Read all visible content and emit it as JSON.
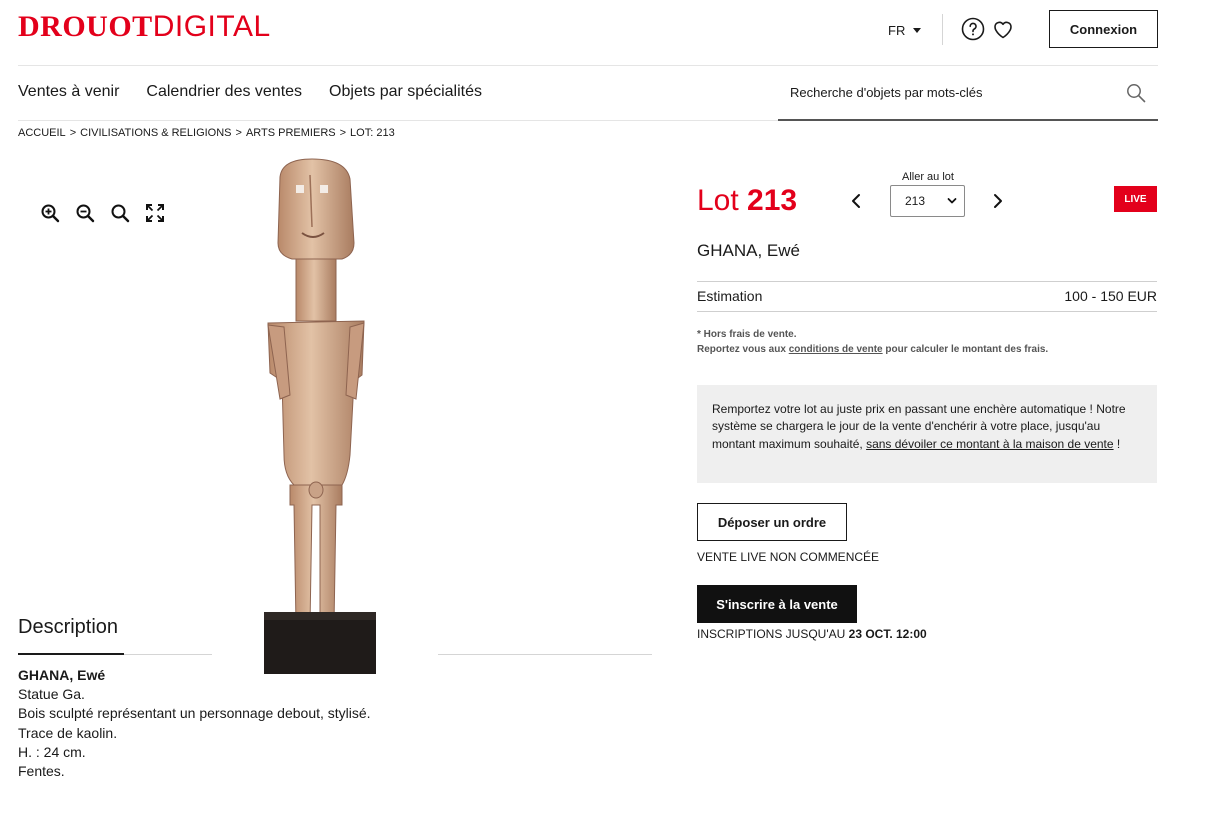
{
  "header": {
    "logo_part1": "DROUOT",
    "logo_part2": "DIGITAL",
    "language": "FR",
    "login_label": "Connexion"
  },
  "nav": {
    "items": [
      "Ventes à venir",
      "Calendrier des ventes",
      "Objets par spécialités"
    ],
    "search_placeholder": "Recherche d'objets par mots-clés"
  },
  "breadcrumb": [
    "ACCUEIL",
    ">",
    "CIVILISATIONS & RELIGIONS",
    ">",
    "ARTS PREMIERS",
    ">",
    "LOT: 213"
  ],
  "lot": {
    "prefix": "Lot ",
    "number": "213",
    "goto_label": "Aller au lot",
    "selected_lot": "213",
    "live_badge": "LIVE",
    "subtitle": "GHANA, Ewé",
    "estimation_label": "Estimation",
    "estimation_value": "100 - 150 EUR",
    "fees_line1": "* Hors frais de vente.",
    "fees_line2_pre": "Reportez vous aux ",
    "fees_link": "conditions de vente",
    "fees_line2_post": " pour calculer le montant des frais.",
    "info_text": "Remportez votre lot au juste prix en passant une enchère automatique ! Notre système se chargera le jour de la vente d'enchérir à votre place, jusqu'au montant maximum souhaité, ",
    "info_link": "sans dévoiler ce montant à la maison de vente",
    "info_end": " !",
    "order_button": "Déposer un ordre",
    "status": "VENTE LIVE NON COMMENCÉE",
    "register_button": "S'inscrire à la vente",
    "deadline_prefix": "INSCRIPTIONS JUSQU'AU ",
    "deadline_value": "23 OCT. 12:00"
  },
  "description": {
    "title": "Description",
    "heading": "GHANA, Ewé",
    "lines": [
      "Statue Ga.",
      "Bois sculpté représentant un personnage debout, stylisé.",
      "Trace de kaolin.",
      "H. : 24 cm.",
      "Fentes."
    ]
  },
  "colors": {
    "brand_red": "#e3001b",
    "dark": "#111111",
    "info_bg": "#efefef"
  },
  "icons": [
    "help-icon",
    "heart-icon",
    "search-icon",
    "zoom-in-icon",
    "zoom-out-icon",
    "zoom-reset-icon",
    "fullscreen-icon",
    "chevron-left-icon",
    "chevron-right-icon",
    "chevron-down-icon"
  ]
}
